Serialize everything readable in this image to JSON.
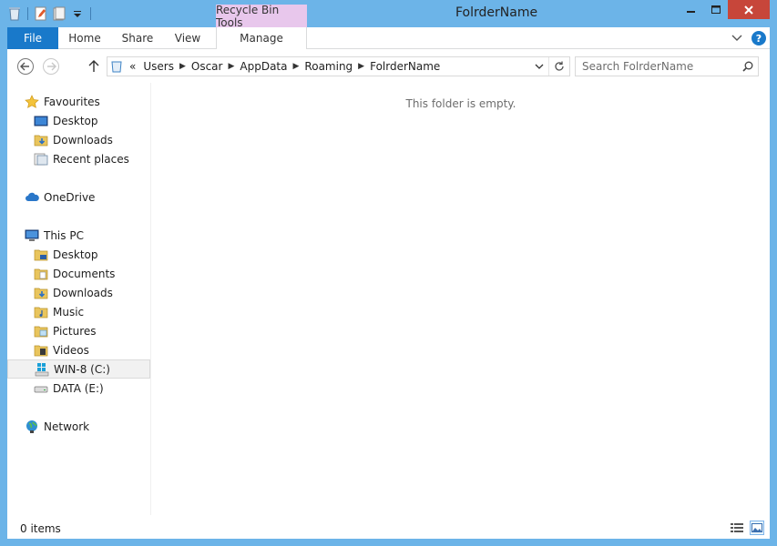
{
  "window": {
    "title": "FolrderName",
    "context_tab_group": "Recycle Bin Tools"
  },
  "ribbon": {
    "tabs": {
      "file": "File",
      "home": "Home",
      "share": "Share",
      "view": "View",
      "manage": "Manage"
    },
    "help_glyph": "?"
  },
  "address": {
    "overflow": "«",
    "crumbs": [
      "Users",
      "Oscar",
      "AppData",
      "Roaming",
      "FolrderName"
    ]
  },
  "search": {
    "placeholder": "Search FolrderName"
  },
  "navpane": {
    "favourites": "Favourites",
    "fav_items": [
      "Desktop",
      "Downloads",
      "Recent places"
    ],
    "onedrive": "OneDrive",
    "thispc": "This PC",
    "pc_items": [
      "Desktop",
      "Documents",
      "Downloads",
      "Music",
      "Pictures",
      "Videos",
      "WIN-8 (C:)",
      "DATA (E:)"
    ],
    "network": "Network"
  },
  "content": {
    "empty_message": "This folder is empty."
  },
  "status": {
    "item_count": "0 items"
  },
  "colors": {
    "frame": "#6cb4e8",
    "file_tab": "#1979ca",
    "context_tab": "#e8c7ec",
    "close_button": "#c7463a"
  }
}
